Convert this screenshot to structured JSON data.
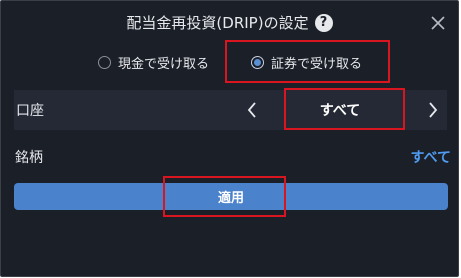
{
  "dialog": {
    "title": "配当金再投資(DRIP)の設定",
    "help_icon": "?",
    "close_icon": "close-icon"
  },
  "payout_options": [
    {
      "label": "現金で受け取る",
      "selected": false
    },
    {
      "label": "証券で受け取る",
      "selected": true
    }
  ],
  "account": {
    "label": "口座",
    "value": "すべて",
    "prev_icon": "chevron-left-icon",
    "next_icon": "chevron-right-icon"
  },
  "brand": {
    "label": "銘柄",
    "link": "すべて"
  },
  "apply_label": "適用",
  "colors": {
    "background": "#1b1f27",
    "row": "#242935",
    "accent": "#4a82cc",
    "link": "#4f9bef",
    "highlight": "#d9161f"
  }
}
